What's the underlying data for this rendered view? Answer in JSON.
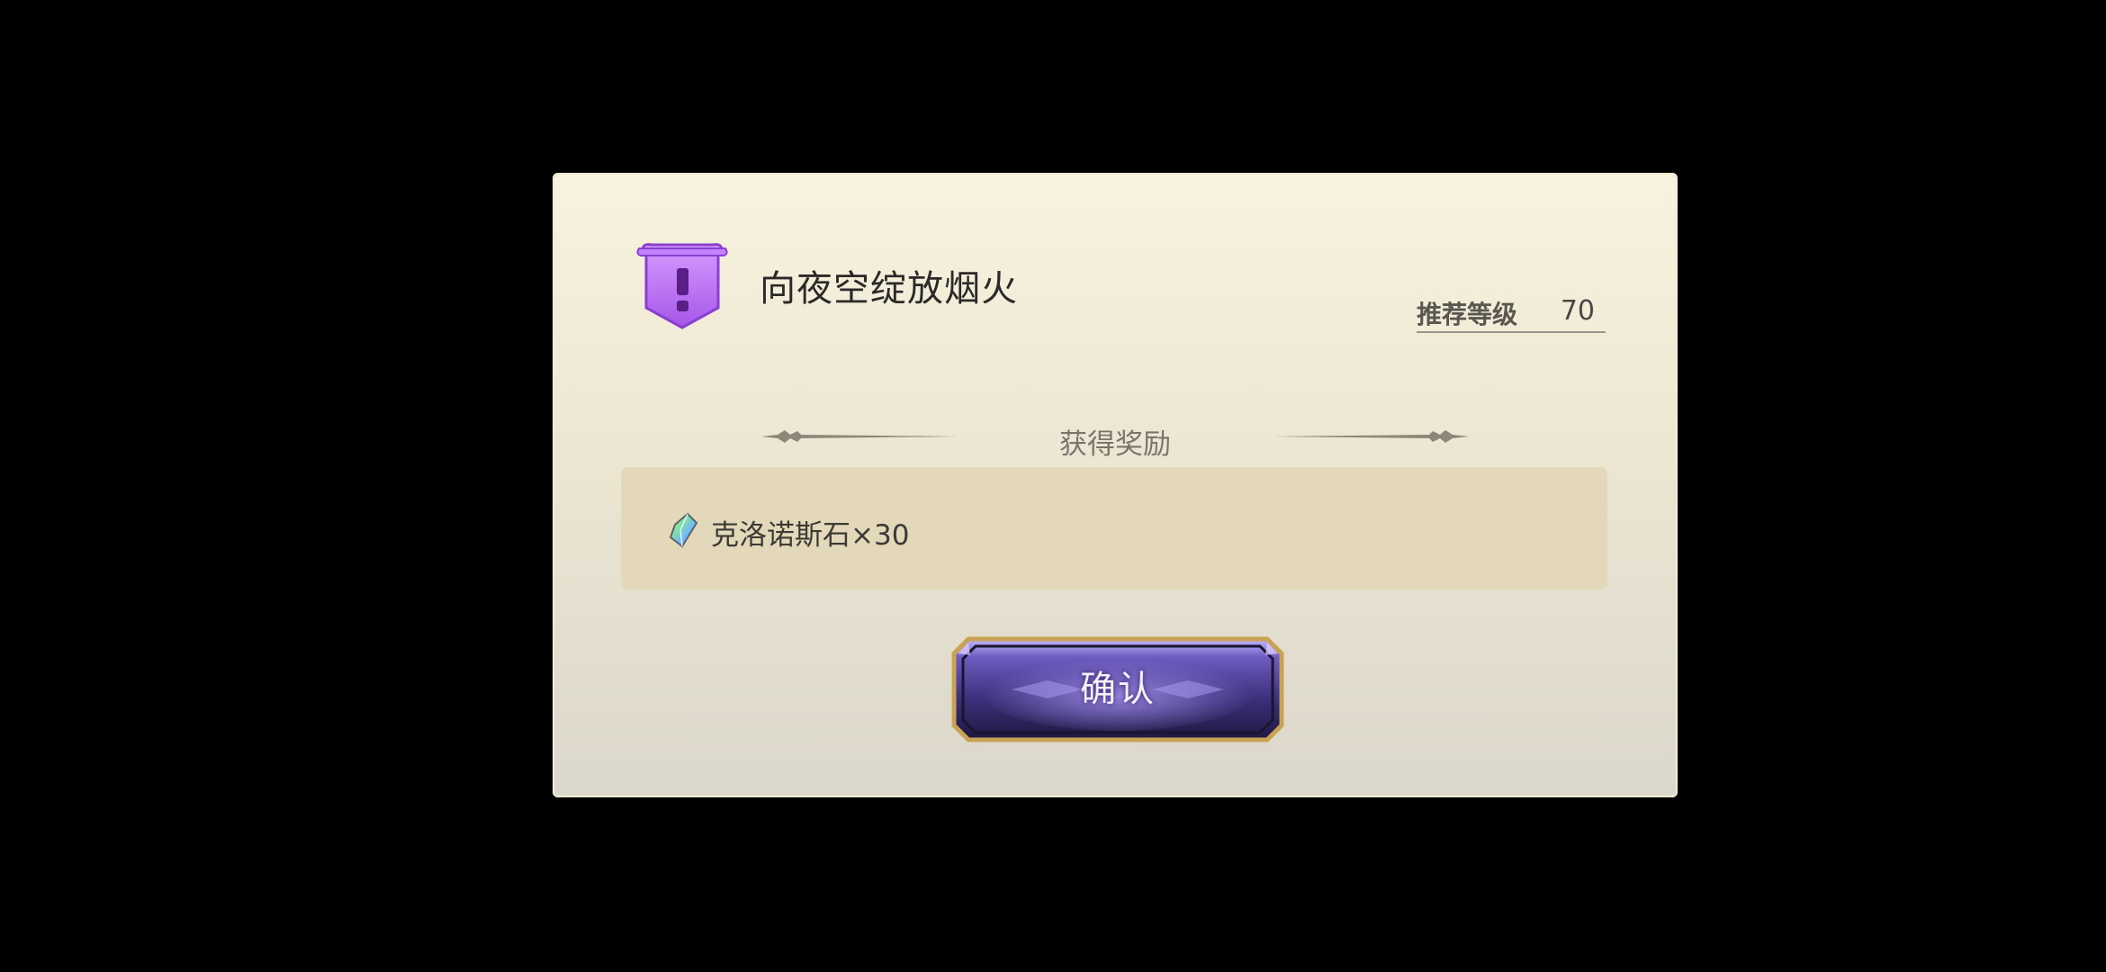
{
  "quest": {
    "badge_icon": "exclamation-shield-icon",
    "title": "向夜空绽放烟火",
    "recommended_level_label": "推荐等级",
    "recommended_level_value": "70"
  },
  "rewards": {
    "heading": "获得奖励",
    "items": [
      {
        "icon": "chronos-stone-crystal-icon",
        "label": "克洛诺斯石×30"
      }
    ]
  },
  "actions": {
    "confirm_label": "确认"
  },
  "colors": {
    "badge_purple": "#b36cf0",
    "button_purple": "#4a3a8a",
    "button_gold": "#c9a352",
    "dialog_background": "#f1ecd9",
    "rewards_box_background": "#e3d8b9"
  }
}
